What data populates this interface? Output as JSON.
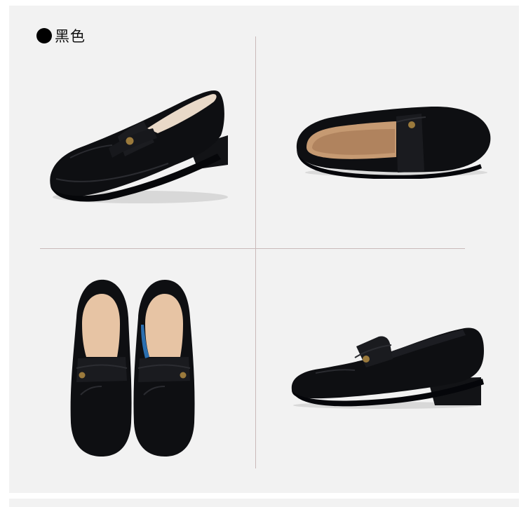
{
  "color_label": "黑色",
  "colors": {
    "panel_bg": "#f2f2f2",
    "shoe_black": "#0e0f12",
    "lining_tan": "#d9b89a",
    "divider": "#c9b9b9"
  },
  "views": [
    {
      "name": "three-quarter-front-view"
    },
    {
      "name": "top-side-view"
    },
    {
      "name": "top-pair-view"
    },
    {
      "name": "side-profile-view"
    }
  ]
}
